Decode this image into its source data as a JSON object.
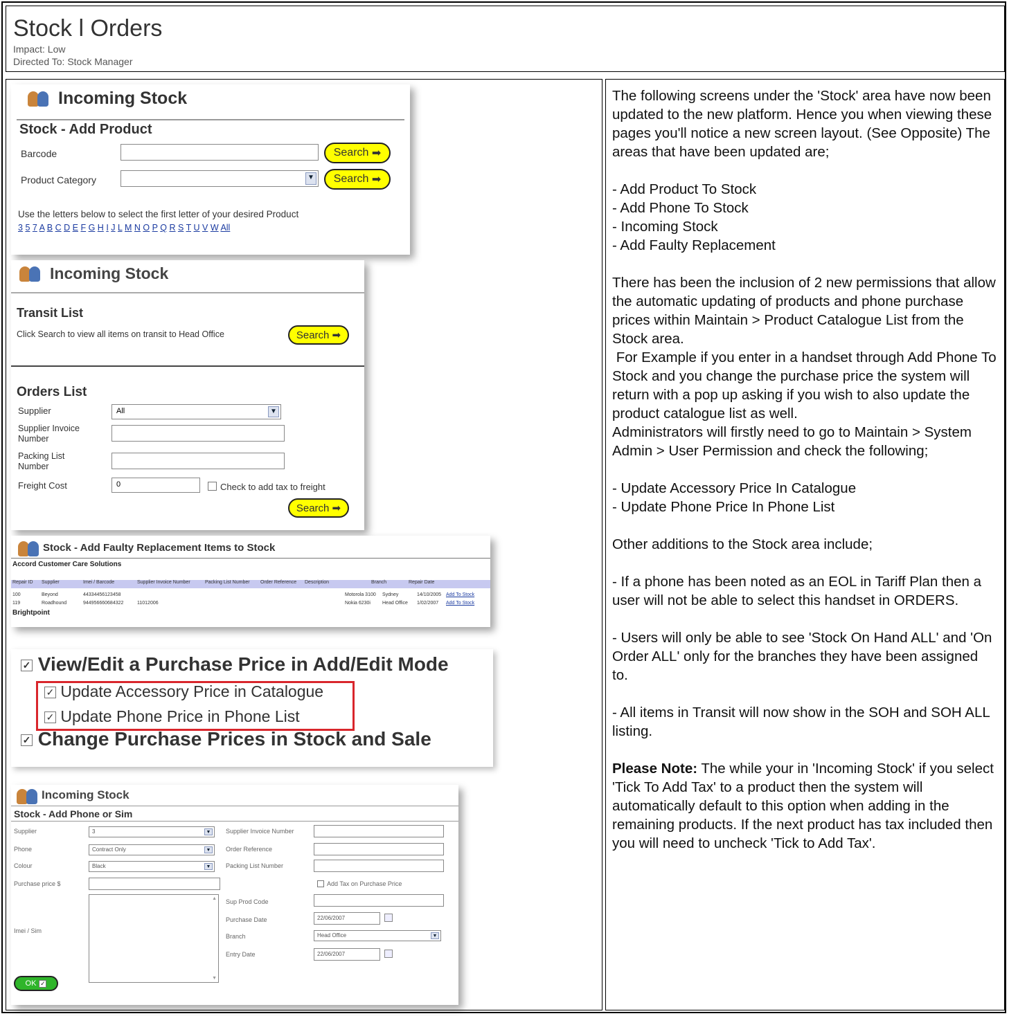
{
  "header": {
    "title": "Stock l Orders",
    "impact": "Impact: Low",
    "directed_to": "Directed To: Stock Manager"
  },
  "description": {
    "intro": "The following screens under the 'Stock' area have now been updated to the new platform. Hence you when viewing these pages you'll notice a new screen layout. (See Opposite) The areas that have been updated are;",
    "updated_areas": [
      "- Add Product To Stock",
      "- Add Phone To Stock",
      "- Incoming Stock",
      "- Add Faulty Replacement"
    ],
    "permissions_p1": "There has been the inclusion of 2 new permissions that allow the automatic updating of products and phone purchase prices within Maintain > Product Catalogue List from the Stock area.",
    "permissions_p2": " For Example if you enter in a handset through Add Phone To Stock and you change the purchase price the system will return with a pop up asking if you wish to also update the product catalogue list as well.",
    "permissions_p3": "Administrators will firstly need to go to Maintain > System Admin > User Permission and check the following;",
    "permissions_list": [
      "- Update Accessory Price In Catalogue",
      "- Update Phone Price In Phone List"
    ],
    "other": "Other additions to the Stock area include;",
    "eol": "- If a phone has been noted as an EOL in Tariff Plan then a user will not be able to select this handset in ORDERS.",
    "soh": "- Users will only be able to see 'Stock On Hand ALL' and 'On Order ALL' only for the branches they have been assigned to.",
    "transit": "- All items in Transit will now show in the SOH and SOH ALL listing.",
    "note_label": "Please Note:",
    "note": " The while your in 'Incoming Stock' if you select 'Tick To Add Tax' to a product then the system will automatically default to this option when adding in the remaining products. If the next product has tax included then you will need to uncheck 'Tick to Add Tax'."
  },
  "shot1": {
    "heading": "Incoming Stock",
    "subheading": "Stock - Add Product",
    "barcode_label": "Barcode",
    "category_label": "Product Category",
    "search": "Search",
    "letters_hint": "Use the letters below to select the first letter of your desired Product",
    "letters": [
      "3",
      "5",
      "7",
      "A",
      "B",
      "C",
      "D",
      "E",
      "F",
      "G",
      "H",
      "I",
      "J",
      "L",
      "M",
      "N",
      "O",
      "P",
      "Q",
      "R",
      "S",
      "T",
      "U",
      "V",
      "W",
      "All"
    ]
  },
  "shot2": {
    "heading": "Incoming Stock",
    "transit_title": "Transit List",
    "transit_hint": "Click Search to view all items on transit to Head Office",
    "search": "Search",
    "orders_title": "Orders List",
    "supplier_label": "Supplier",
    "supplier_value": "All",
    "invoice_label": "Supplier Invoice Number",
    "packing_label": "Packing List Number",
    "freight_label": "Freight Cost",
    "freight_value": "0",
    "freight_tax": "Check to add tax to freight"
  },
  "shot3": {
    "heading": "Stock - Add Faulty Replacement Items to Stock",
    "group1": "Accord Customer Care Solutions",
    "columns": [
      "Repair ID",
      "Supplier",
      "Imei / Barcode",
      "Supplier Invoice Number",
      "Packing List Number",
      "Order Reference",
      "Description",
      "Branch",
      "Repair Date"
    ],
    "rows": [
      {
        "id": "100",
        "supplier": "Beyond",
        "imei": "44334456123458",
        "invoice": "",
        "desc": "Motorola 3100",
        "branch": "Sydney",
        "date": "14/10/2005",
        "link": "Add To Stock"
      },
      {
        "id": "119",
        "supplier": "Roadhound",
        "imei": "944956660684322",
        "invoice": "11012006",
        "desc": "Nokia 6230i",
        "branch": "Head Office",
        "date": "1/02/2007",
        "link": "Add To Stock"
      }
    ],
    "group2": "Brightpoint"
  },
  "shot4": {
    "perm_main": "View/Edit a Purchase Price in Add/Edit Mode",
    "perm_accessory": "Update Accessory Price in Catalogue",
    "perm_phone": "Update Phone Price in Phone List",
    "perm_change": "Change Purchase Prices in Stock and Sale"
  },
  "shot5": {
    "heading": "Incoming Stock",
    "subheading": "Stock - Add Phone or Sim",
    "supplier_label": "Supplier",
    "supplier_value": "3",
    "phone_label": "Phone",
    "phone_value": "Contract Only",
    "colour_label": "Colour",
    "colour_value": "Black",
    "price_label": "Purchase price $",
    "imei_label": "Imei / Sim",
    "invoice_label": "Supplier Invoice Number",
    "order_ref_label": "Order Reference",
    "packing_label": "Packing List Number",
    "tax_label": "Add Tax on Purchase Price",
    "sup_code_label": "Sup Prod Code",
    "purchase_date_label": "Purchase Date",
    "purchase_date_value": "22/06/2007",
    "branch_label": "Branch",
    "branch_value": "Head Office",
    "entry_date_label": "Entry Date",
    "entry_date_value": "22/06/2007",
    "ok": "OK"
  },
  "colors": {
    "search_yellow": "#ffff00",
    "highlight_red": "#d9262c",
    "ok_green": "#2fb52a",
    "link_blue": "#1a3aa0"
  }
}
